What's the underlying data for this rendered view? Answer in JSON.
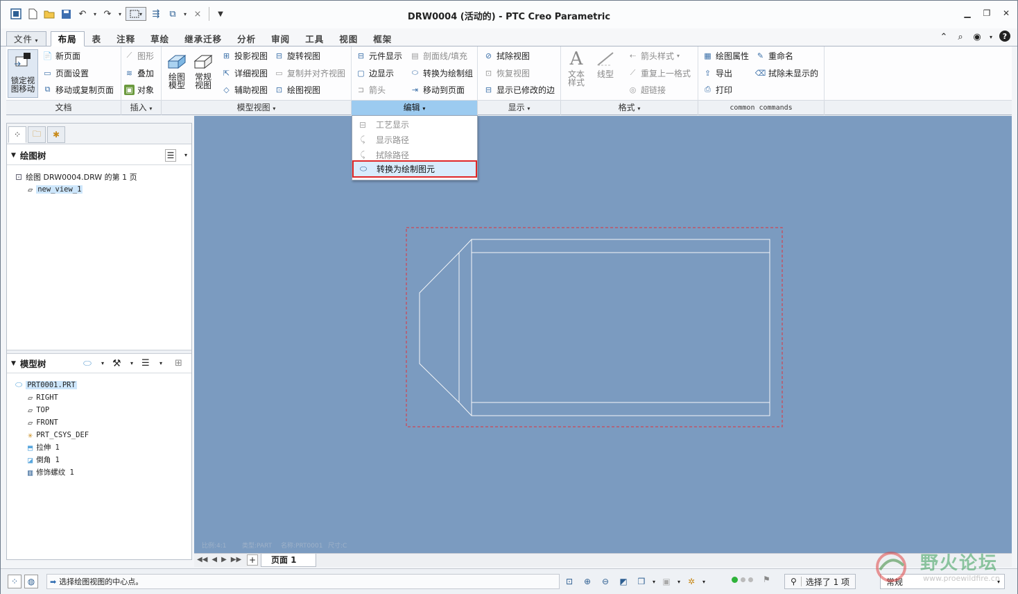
{
  "window": {
    "title": "DRW0004 (活动的) - PTC Creo Parametric"
  },
  "tabs": [
    {
      "label": "文件",
      "type": "file"
    },
    {
      "label": "布局",
      "active": true
    },
    {
      "label": "表"
    },
    {
      "label": "注释"
    },
    {
      "label": "草绘"
    },
    {
      "label": "继承迁移"
    },
    {
      "label": "分析"
    },
    {
      "label": "审阅"
    },
    {
      "label": "工具"
    },
    {
      "label": "视图"
    },
    {
      "label": "框架"
    }
  ],
  "ribbon": {
    "doc": {
      "lock_view": "锁定视\n图移动",
      "new_page": "新页面",
      "page_setup": "页面设置",
      "move_copy_page": "移动或复制页面",
      "group": "文档"
    },
    "insert": {
      "graphic": "图形",
      "overlay": "叠加",
      "object": "对象",
      "group": "插入"
    },
    "model_views": {
      "drawing_model": "绘图\n模型",
      "general_view": "常规\n视图",
      "projection": "投影视图",
      "detail": "详细视图",
      "auxiliary": "辅助视图",
      "revolved": "旋转视图",
      "copy_align": "复制并对齐视图",
      "drawing_view": "绘图视图",
      "group": "模型视图"
    },
    "edit": {
      "component_display": "元件显示",
      "section_line_fill": "剖面线/填充",
      "edge_display": "边显示",
      "arrow": "箭头",
      "convert_draw_group": "转换为绘制组",
      "move_to_page": "移动到页面",
      "group": "编辑"
    },
    "display": {
      "erase_view": "拭除视图",
      "restore_view": "恢复视图",
      "show_modified_edges": "显示已修改的边",
      "group": "显示"
    },
    "format": {
      "text_style": "文本\n样式",
      "line_style": "线型",
      "arrow_style": "箭头样式",
      "repeat_format": "重复上一格式",
      "hyperlink": "超链接",
      "group": "格式"
    },
    "common": {
      "drawing_props": "绘图属性",
      "rename": "重命名",
      "export": "导出",
      "erase_undisplayed": "拭除未显示的",
      "print": "打印",
      "group": "common commands"
    }
  },
  "dropdown": {
    "items": [
      {
        "label": "工艺显示",
        "disabled": true
      },
      {
        "label": "显示路径",
        "disabled": true
      },
      {
        "label": "拭除路径",
        "disabled": true
      },
      {
        "label": "转换为绘制图元",
        "highlighted": true
      }
    ]
  },
  "drawing_tree": {
    "title": "绘图树",
    "items": [
      {
        "label": "绘图 DRW0004.DRW 的第 1 页"
      },
      {
        "label": "new_view_1",
        "selected": true
      }
    ]
  },
  "model_tree": {
    "title": "模型树",
    "items": [
      {
        "label": "PRT0001.PRT",
        "selected": true
      },
      {
        "label": "RIGHT"
      },
      {
        "label": "TOP"
      },
      {
        "label": "FRONT"
      },
      {
        "label": "PRT_CSYS_DEF"
      },
      {
        "label": "拉伸 1"
      },
      {
        "label": "倒角 1"
      },
      {
        "label": "修饰螺纹 1"
      }
    ]
  },
  "canvas": {
    "bg": "#7b9bc0",
    "faint_labels": [
      "比例:4:1",
      "类型:PART",
      "名称:PRT0001",
      "尺寸:C"
    ]
  },
  "page_bar": {
    "page_label": "页面 1",
    "add": "+"
  },
  "status": {
    "message": "选择绘图视图的中心点。",
    "selected": "选择了 1 项",
    "filter": "常规"
  },
  "watermark": {
    "text": "野火论坛",
    "url": "www.proewildfire.cn"
  }
}
